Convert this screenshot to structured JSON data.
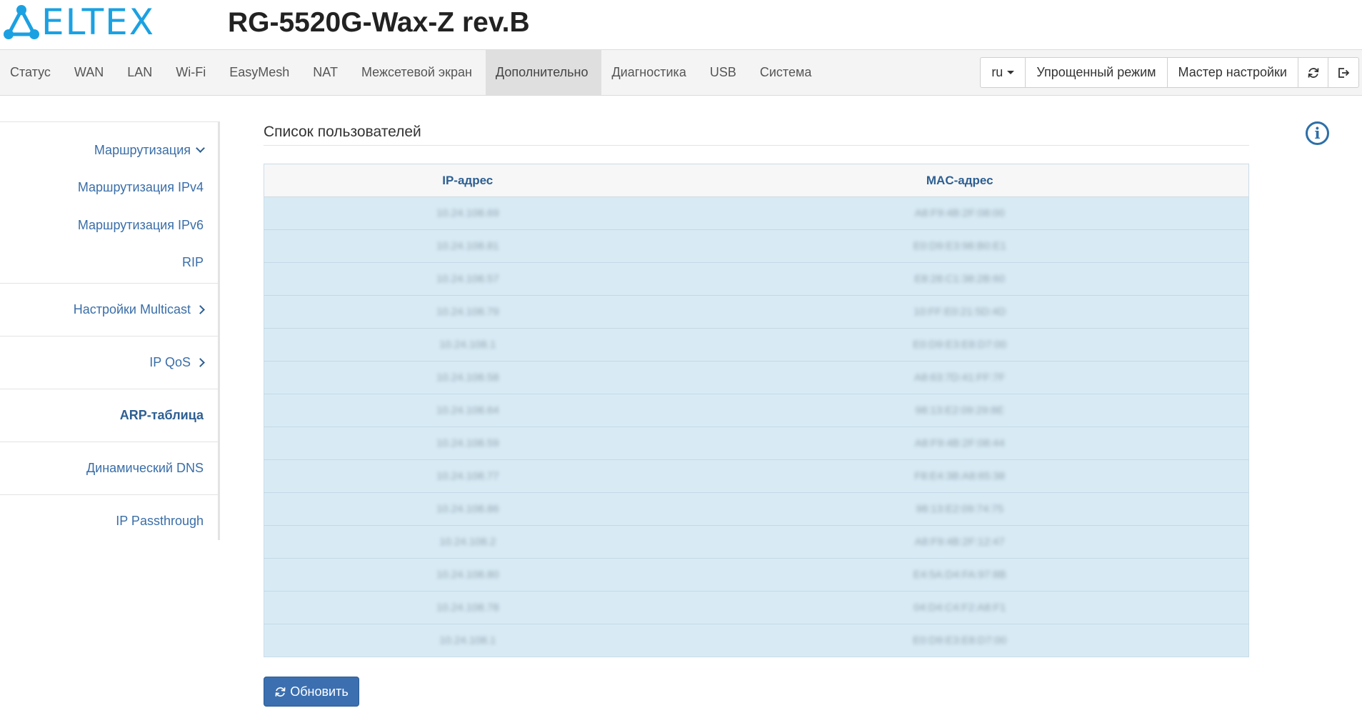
{
  "brand": {
    "logo_text": "ELTEX",
    "accent_color": "#1ba1e2"
  },
  "header": {
    "product_title": "RG-5520G-Wax-Z rev.B"
  },
  "topnav": {
    "items": [
      {
        "label": "Статус"
      },
      {
        "label": "WAN"
      },
      {
        "label": "LAN"
      },
      {
        "label": "Wi-Fi"
      },
      {
        "label": "EasyMesh"
      },
      {
        "label": "NAT"
      },
      {
        "label": "Межсетевой экран"
      },
      {
        "label": "Дополнительно",
        "active": true
      },
      {
        "label": "Диагностика"
      },
      {
        "label": "USB"
      },
      {
        "label": "Система"
      }
    ],
    "language": "ru",
    "simple_mode_label": "Упрощенный режим",
    "wizard_label": "Мастер настройки",
    "refresh_icon": "refresh-icon",
    "logout_icon": "logout-icon"
  },
  "sidebar": {
    "routing": {
      "label": "Маршрутизация",
      "items": [
        {
          "label": "Маршрутизация IPv4"
        },
        {
          "label": "Маршрутизация IPv6"
        },
        {
          "label": "RIP"
        }
      ]
    },
    "multicast": {
      "label": "Настройки Multicast"
    },
    "qos": {
      "label": "IP QoS"
    },
    "arp": {
      "label": "ARP-таблица",
      "active": true
    },
    "ddns": {
      "label": "Динамический DNS"
    },
    "passthrough": {
      "label": "IP Passthrough"
    }
  },
  "main": {
    "title": "Список пользователей",
    "table": {
      "columns": [
        "IP-адрес",
        "MAC-адрес"
      ],
      "rows": [
        {
          "ip": "10.24.108.69",
          "mac": "A8:F9:4B:2F:08:00"
        },
        {
          "ip": "10.24.108.81",
          "mac": "E0:D9:E3:98:B0:E1"
        },
        {
          "ip": "10.24.108.57",
          "mac": "E8:28:C1:38:2B:60"
        },
        {
          "ip": "10.24.108.79",
          "mac": "10:FF:E0:21:5D:4D"
        },
        {
          "ip": "10.24.108.1",
          "mac": "E0:D9:E3:E8:D7:00"
        },
        {
          "ip": "10.24.108.58",
          "mac": "A8:63:7D:41:FF:7F"
        },
        {
          "ip": "10.24.108.64",
          "mac": "98:13:E2:09:29:8E"
        },
        {
          "ip": "10.24.108.59",
          "mac": "A8:F9:4B:2F:08:44"
        },
        {
          "ip": "10.24.108.77",
          "mac": "F8:E4:3B:A8:65:38"
        },
        {
          "ip": "10.24.108.86",
          "mac": "98:13:E2:09:74:75"
        },
        {
          "ip": "10.24.108.2",
          "mac": "A8:F9:4B:2F:12:47"
        },
        {
          "ip": "10.24.108.80",
          "mac": "E4:5A:D4:FA:97:8B"
        },
        {
          "ip": "10.24.108.78",
          "mac": "04:D4:C4:F2:A8:F1"
        },
        {
          "ip": "10.24.108.1",
          "mac": "E0:D9:E3:E8:D7:00"
        }
      ]
    },
    "refresh_button_label": "Обновить"
  }
}
